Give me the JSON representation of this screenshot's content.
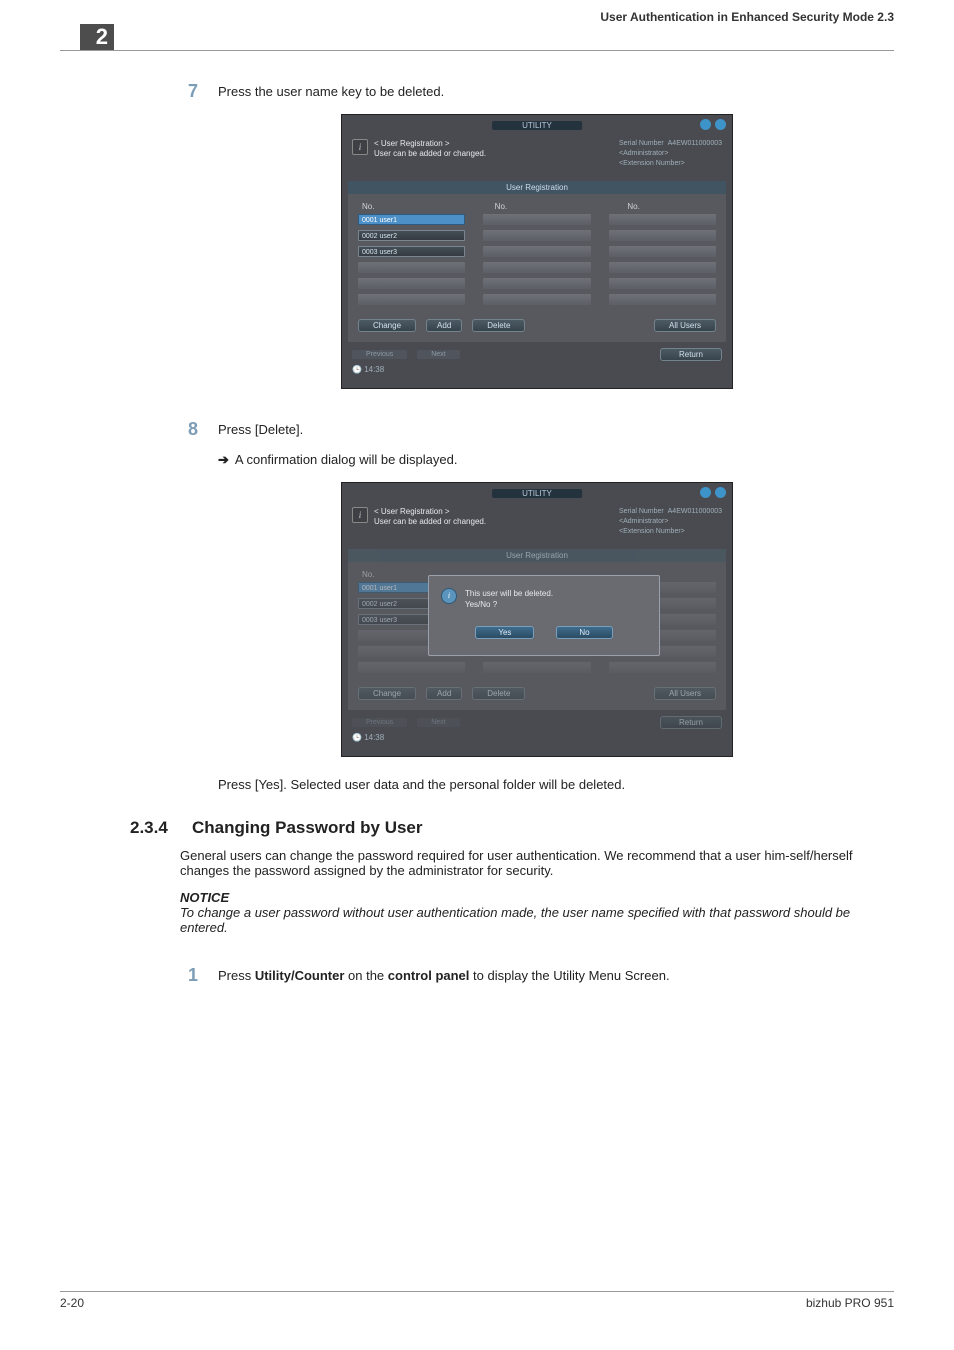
{
  "header": {
    "chapter_num": "2",
    "right_text": "User Authentication in Enhanced Security Mode    2.3"
  },
  "steps": {
    "s7": {
      "num": "7",
      "text": "Press the user name key to be deleted."
    },
    "s8": {
      "num": "8",
      "text": "Press [Delete].",
      "sub": "A confirmation dialog will be displayed."
    },
    "after8": "Press [Yes]. Selected user data and the personal folder will be deleted.",
    "s1": {
      "num": "1",
      "text_before": "Press ",
      "b1": "Utility/Counter",
      "mid": " on the ",
      "b2": "control panel",
      "after": " to display the Utility Menu Screen."
    }
  },
  "section": {
    "num": "2.3.4",
    "title": "Changing Password by User",
    "body": "General users can change the password required for user authentication. We recommend that a user him-self/herself changes the password assigned by the administrator for security.",
    "notice_head": "NOTICE",
    "notice_body": "To change a user password without user authentication made, the user name specified with that password should be entered."
  },
  "footer": {
    "left": "2-20",
    "right": "bizhub PRO 951"
  },
  "shot": {
    "title": "UTILITY",
    "head_l1": "< User Registration >",
    "head_l2": "User can be added or changed.",
    "serial_lbl": "Serial Number",
    "serial_val": "A4EW011000003",
    "admin": "<Administrator>",
    "ext": "<Extension Number>",
    "panel_title": "User Registration",
    "no_label": "No.",
    "users": {
      "u1": "0001 user1",
      "u2": "0002 user2",
      "u3": "0003 user3"
    },
    "btn_change": "Change",
    "btn_add": "Add",
    "btn_delete": "Delete",
    "btn_allusers": "All Users",
    "btn_return": "Return",
    "nav_prev": "Previous",
    "nav_next": "Next",
    "clock": "14:38",
    "dialog_l1": "This user will be deleted.",
    "dialog_l2": "Yes/No ?",
    "dialog_yes": "Yes",
    "dialog_no": "No"
  }
}
